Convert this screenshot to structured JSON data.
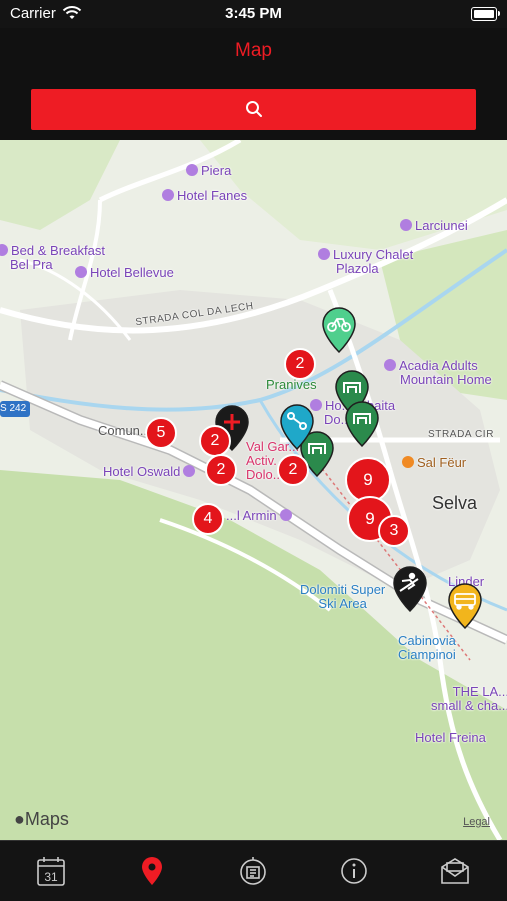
{
  "status_bar": {
    "carrier": "Carrier",
    "time": "3:45 PM"
  },
  "nav": {
    "title": "Map"
  },
  "search": {
    "icon": "search-icon"
  },
  "map": {
    "labels": {
      "piera": "Piera",
      "hotel_fanes": "Hotel Fanes",
      "larciunei": "Larciunei",
      "bb": "Bed & Breakfast",
      "bel_pra": "Bel Pra",
      "hotel_bellevue": "Hotel Bellevue",
      "luxury_chalet": "Luxury Chalet",
      "plazola": "Plazola",
      "strada_col": "STRADA COL DA LECH",
      "acadia_1": "Acadia Adults",
      "acadia_2": "Mountain Home",
      "pranives": "Pranives",
      "hotel_sanbaita_1": "Ho...anbaita",
      "hotel_sanbaita_2": "Do...s",
      "strada_cir": "STRADA CIR",
      "ss242": "S 242",
      "comun": "Comun...elva",
      "val_gar": "Val Gar...",
      "activ": "Activ...",
      "dolo": "Dolo...",
      "sal_feur": "Sal Fëur",
      "hotel_oswald": "Hotel Oswald",
      "selva": "Selva",
      "armin": "...l Armin",
      "linder": "Linder",
      "dolomiti_super_1": "Dolomiti Super",
      "dolomiti_super_2": "Ski Area",
      "cabinovia_1": "Cabinovia",
      "cabinovia_2": "Ciampinoi",
      "the_la_1": "THE LA...",
      "the_la_2": "small & cha...",
      "hotel_freina": "Hotel Freina"
    },
    "clusters": [
      "2",
      "5",
      "2",
      "2",
      "2",
      "9",
      "4",
      "9",
      "3"
    ],
    "pins": {
      "bike": "bike-icon",
      "shelter_1": "shelter-icon",
      "shelter_2": "shelter-icon",
      "shelter_3": "shelter-icon",
      "lift": "lift-icon",
      "ski": "ski-school-icon",
      "bus": "bus-icon",
      "first_aid": "first-aid-icon"
    },
    "attribution": {
      "logo": "Maps",
      "legal": "Legal"
    }
  },
  "tabbar": {
    "calendar_day": "31",
    "items": [
      "calendar-icon",
      "map-pin-icon",
      "ski-pass-icon",
      "info-icon",
      "messages-icon"
    ]
  },
  "colors": {
    "accent": "#ee1c24",
    "background": "#141414",
    "cluster": "#e3151b",
    "pin_green": "#2b8a4c",
    "pin_cyan": "#1fa8c9",
    "pin_yellow": "#f2b51c",
    "pin_black": "#1a1a1a"
  }
}
